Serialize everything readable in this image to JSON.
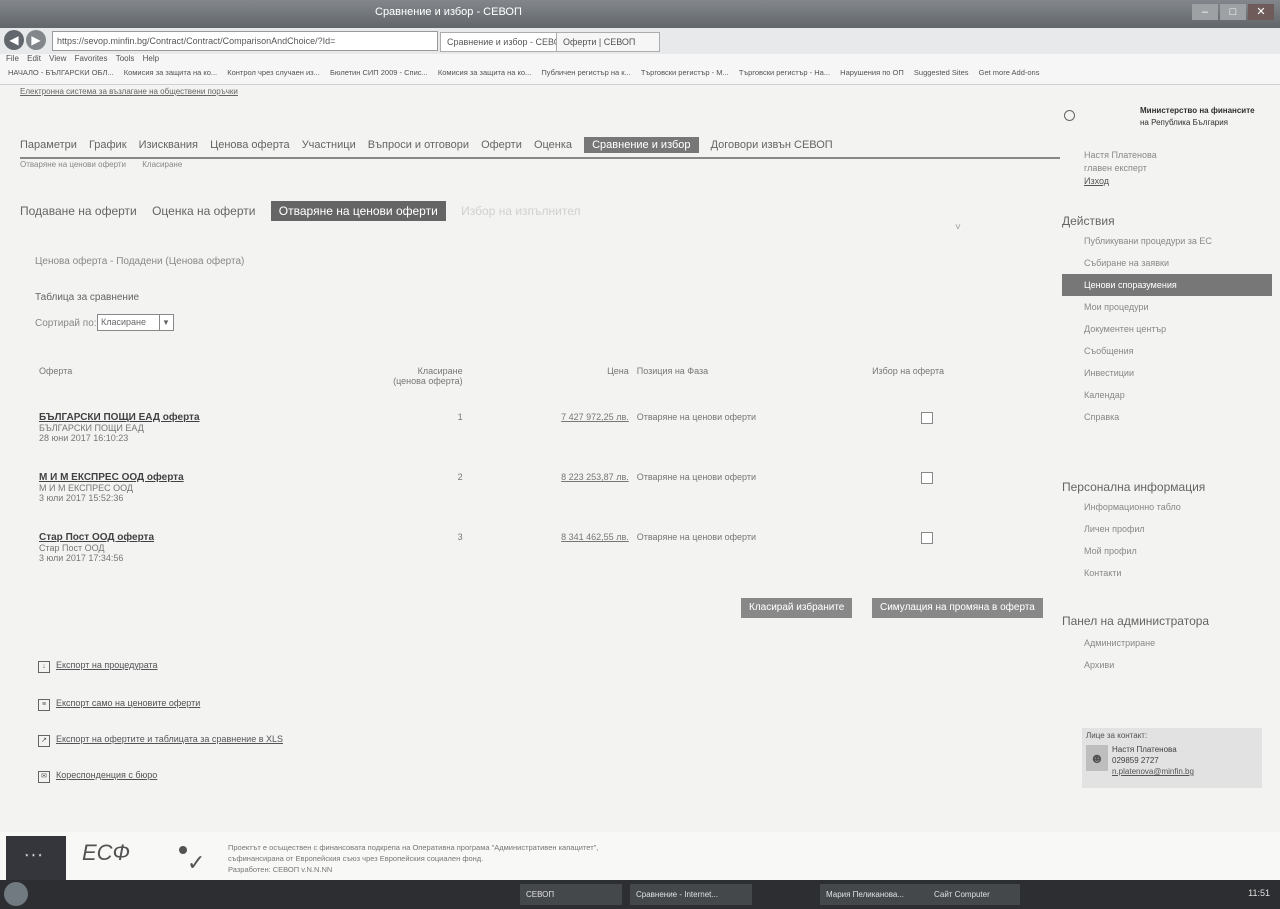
{
  "window": {
    "title": "Сравнение и избор - СЕВОП"
  },
  "browser": {
    "url": "https://sevop.minfin.bg/Contract/Contract/ComparisonAndChoice/?Id=",
    "tabs": [
      "Сравнение и избор - СЕВОП",
      "Оферти | СЕВОП"
    ],
    "menu": [
      "File",
      "Edit",
      "View",
      "Favorites",
      "Tools",
      "Help"
    ],
    "favorites": [
      "НАЧАЛО - БЪЛГАРСКИ ОБЛ...",
      "Комисия за защита на ко...",
      "Контрол чрез случаен из...",
      "Бюлетин СИП 2009 - Спис...",
      "Комисия за защита на ко...",
      "Публичен регистър на к...",
      "Търговски регистър - М...",
      "Търговски регистър - На...",
      "Нарушения по ОП",
      "Suggested Sites",
      "Get more Add-ons"
    ]
  },
  "page": {
    "top_link": "Електронна система за възлагане на обществени поръчки",
    "main_nav": [
      {
        "label": "Параметри",
        "active": false
      },
      {
        "label": "График",
        "active": false
      },
      {
        "label": "Изисквания",
        "active": false
      },
      {
        "label": "Ценова оферта",
        "active": false
      },
      {
        "label": "Участници",
        "active": false
      },
      {
        "label": "Въпроси и отговори",
        "active": false
      },
      {
        "label": "Оферти",
        "active": false
      },
      {
        "label": "Оценка",
        "active": false
      },
      {
        "label": "Сравнение и избор",
        "active": true
      },
      {
        "label": "Договори извън СЕВОП",
        "active": false
      }
    ],
    "sub_nav": [
      "Отваряне на ценови оферти",
      "Класиране"
    ],
    "steps": [
      {
        "label": "Подаване на оферти",
        "state": "done"
      },
      {
        "label": "Оценка на оферти",
        "state": "done"
      },
      {
        "label": "Отваряне на ценови оферти",
        "state": "active"
      },
      {
        "label": "Избор на изпълнител",
        "state": "pending"
      }
    ],
    "info_line": "Ценова оферта - Подадени (Ценова оферта)",
    "table_title": "Таблица за сравнение",
    "sort_label": "Сортирай по:",
    "sort_value": "Класиране",
    "columns": {
      "offer": "Оферта",
      "rank": "Класиране",
      "rank_sub": "(ценова оферта)",
      "price": "Цена",
      "status": "Позиция на Фаза",
      "select": "Избор на оферта"
    },
    "offers": [
      {
        "name": "БЪЛГАРСКИ ПОЩИ ЕАД оферта",
        "company": "БЪЛГАРСКИ ПОЩИ ЕАД",
        "date": "28 юни 2017 16:10:23",
        "rank": "1",
        "price": "7 427 972,25 лв.",
        "status": "Отваряне на ценови оферти"
      },
      {
        "name": "М И М ЕКСПРЕС ООД оферта",
        "company": "М И М ЕКСПРЕС ООД",
        "date": "3 юли 2017 15:52:36",
        "rank": "2",
        "price": "8 223 253,87 лв.",
        "status": "Отваряне на ценови оферти"
      },
      {
        "name": "Стар Пост ООД оферта",
        "company": "Стар Пост ООД",
        "date": "3 юли 2017 17:34:56",
        "rank": "3",
        "price": "8 341 462,55 лв.",
        "status": "Отваряне на ценови оферти"
      }
    ],
    "buttons": {
      "save_selected": "Класирай избраните",
      "simulate": "Симулация на промяна в оферта"
    },
    "bottom_links": [
      "Експорт на процедурата",
      "Експорт само на ценовите оферти",
      "Експорт на офертите и таблицата за сравнение в XLS",
      "Кореспонденция с бюро"
    ]
  },
  "sidebar": {
    "org_line1": "Министерство на финансите",
    "org_line2": "на Република България",
    "user_name": "Настя Платенова",
    "user_role": "главен експерт",
    "logout": "Изход",
    "actions_title": "Действия",
    "actions": [
      {
        "label": "Публикувани процедури за ЕС",
        "active": false
      },
      {
        "label": "Събиране на заявки",
        "active": false
      },
      {
        "label": "Ценови споразумения",
        "active": true
      },
      {
        "label": "Мои процедури",
        "active": false
      },
      {
        "label": "Документен център",
        "active": false
      },
      {
        "label": "Съобщения",
        "active": false
      },
      {
        "label": "Инвестиции",
        "active": false
      },
      {
        "label": "Календар",
        "active": false
      },
      {
        "label": "Справка",
        "active": false
      }
    ],
    "personal_title": "Персонална информация",
    "personal": [
      "Информационно табло",
      "Личен профил",
      "Мой профил",
      "Контакти"
    ],
    "admin_title": "Панел на администратора",
    "admin": [
      "Администриране",
      "Архиви"
    ],
    "contact_title": "Лице за контакт:",
    "contact_name": "Настя Платенова",
    "contact_phone": "029859 2727",
    "contact_email": "n.platenova@minfin.bg"
  },
  "footer": {
    "esf": "ЕСФ",
    "text1": "Проектът е осъществен с финансовата подкрепа на Оперативна програма \"Административен капацитет\",",
    "text2": "съфинансирана от Европейския съюз чрез Европейския социален фонд.",
    "text3": "Разработен: СЕВОП v.N.N.NN"
  },
  "taskbar": {
    "items": [
      "СЕВОП",
      "Сравнение - Internet...",
      "Мария Пеликанова...",
      "Сайт Computer"
    ],
    "time": "11:51"
  }
}
